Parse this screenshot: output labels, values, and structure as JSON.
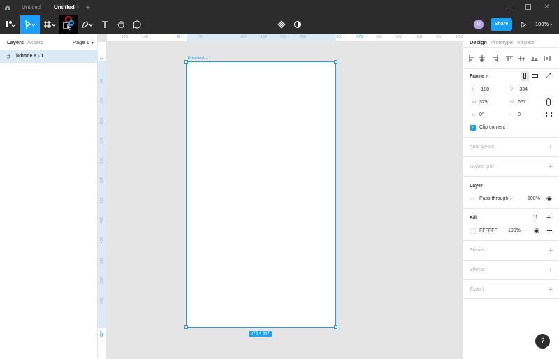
{
  "tabs": {
    "first": "Untitled",
    "active": "Untitled"
  },
  "toolbar": {
    "avatar": "D",
    "share": "Share",
    "zoom": "100%"
  },
  "left": {
    "tab_layers": "Layers",
    "tab_assets": "Assets",
    "page": "Page 1",
    "layer_name": "iPhone 8 - 1"
  },
  "ruler": {
    "top": [
      "-150",
      "-100",
      "0",
      "50",
      "100",
      "150",
      "200",
      "250",
      "300",
      "375",
      "450",
      "500",
      "550",
      "600",
      "650"
    ],
    "left": [
      "0",
      "50",
      "100",
      "150",
      "200",
      "250",
      "300",
      "350",
      "400",
      "450",
      "500",
      "550",
      "600",
      "667"
    ]
  },
  "frame": {
    "label": "iPhone 8 - 1",
    "size": "375 × 667"
  },
  "right": {
    "tabs": [
      "Design",
      "Prototype",
      "Inspect"
    ],
    "frame_title": "Frame",
    "x_label": "X",
    "x": "-188",
    "y_label": "Y",
    "y": "-334",
    "w_label": "W",
    "w": "375",
    "h_label": "H",
    "h": "667",
    "rotation": "0°",
    "radius": "0",
    "clip": "Clip content",
    "auto_layout": "Auto layout",
    "layout_grid": "Layout grid",
    "layer_title": "Layer",
    "blend": "Pass through",
    "layer_opacity": "100%",
    "fill_title": "Fill",
    "fill_hex": "FFFFFF",
    "fill_opacity": "100%",
    "stroke": "Stroke",
    "effects": "Effects",
    "export": "Export"
  },
  "help": "?",
  "colors": {
    "accent": "#18a0fb",
    "dark": "#2c2c2c",
    "canvas": "#e5e5e5"
  }
}
